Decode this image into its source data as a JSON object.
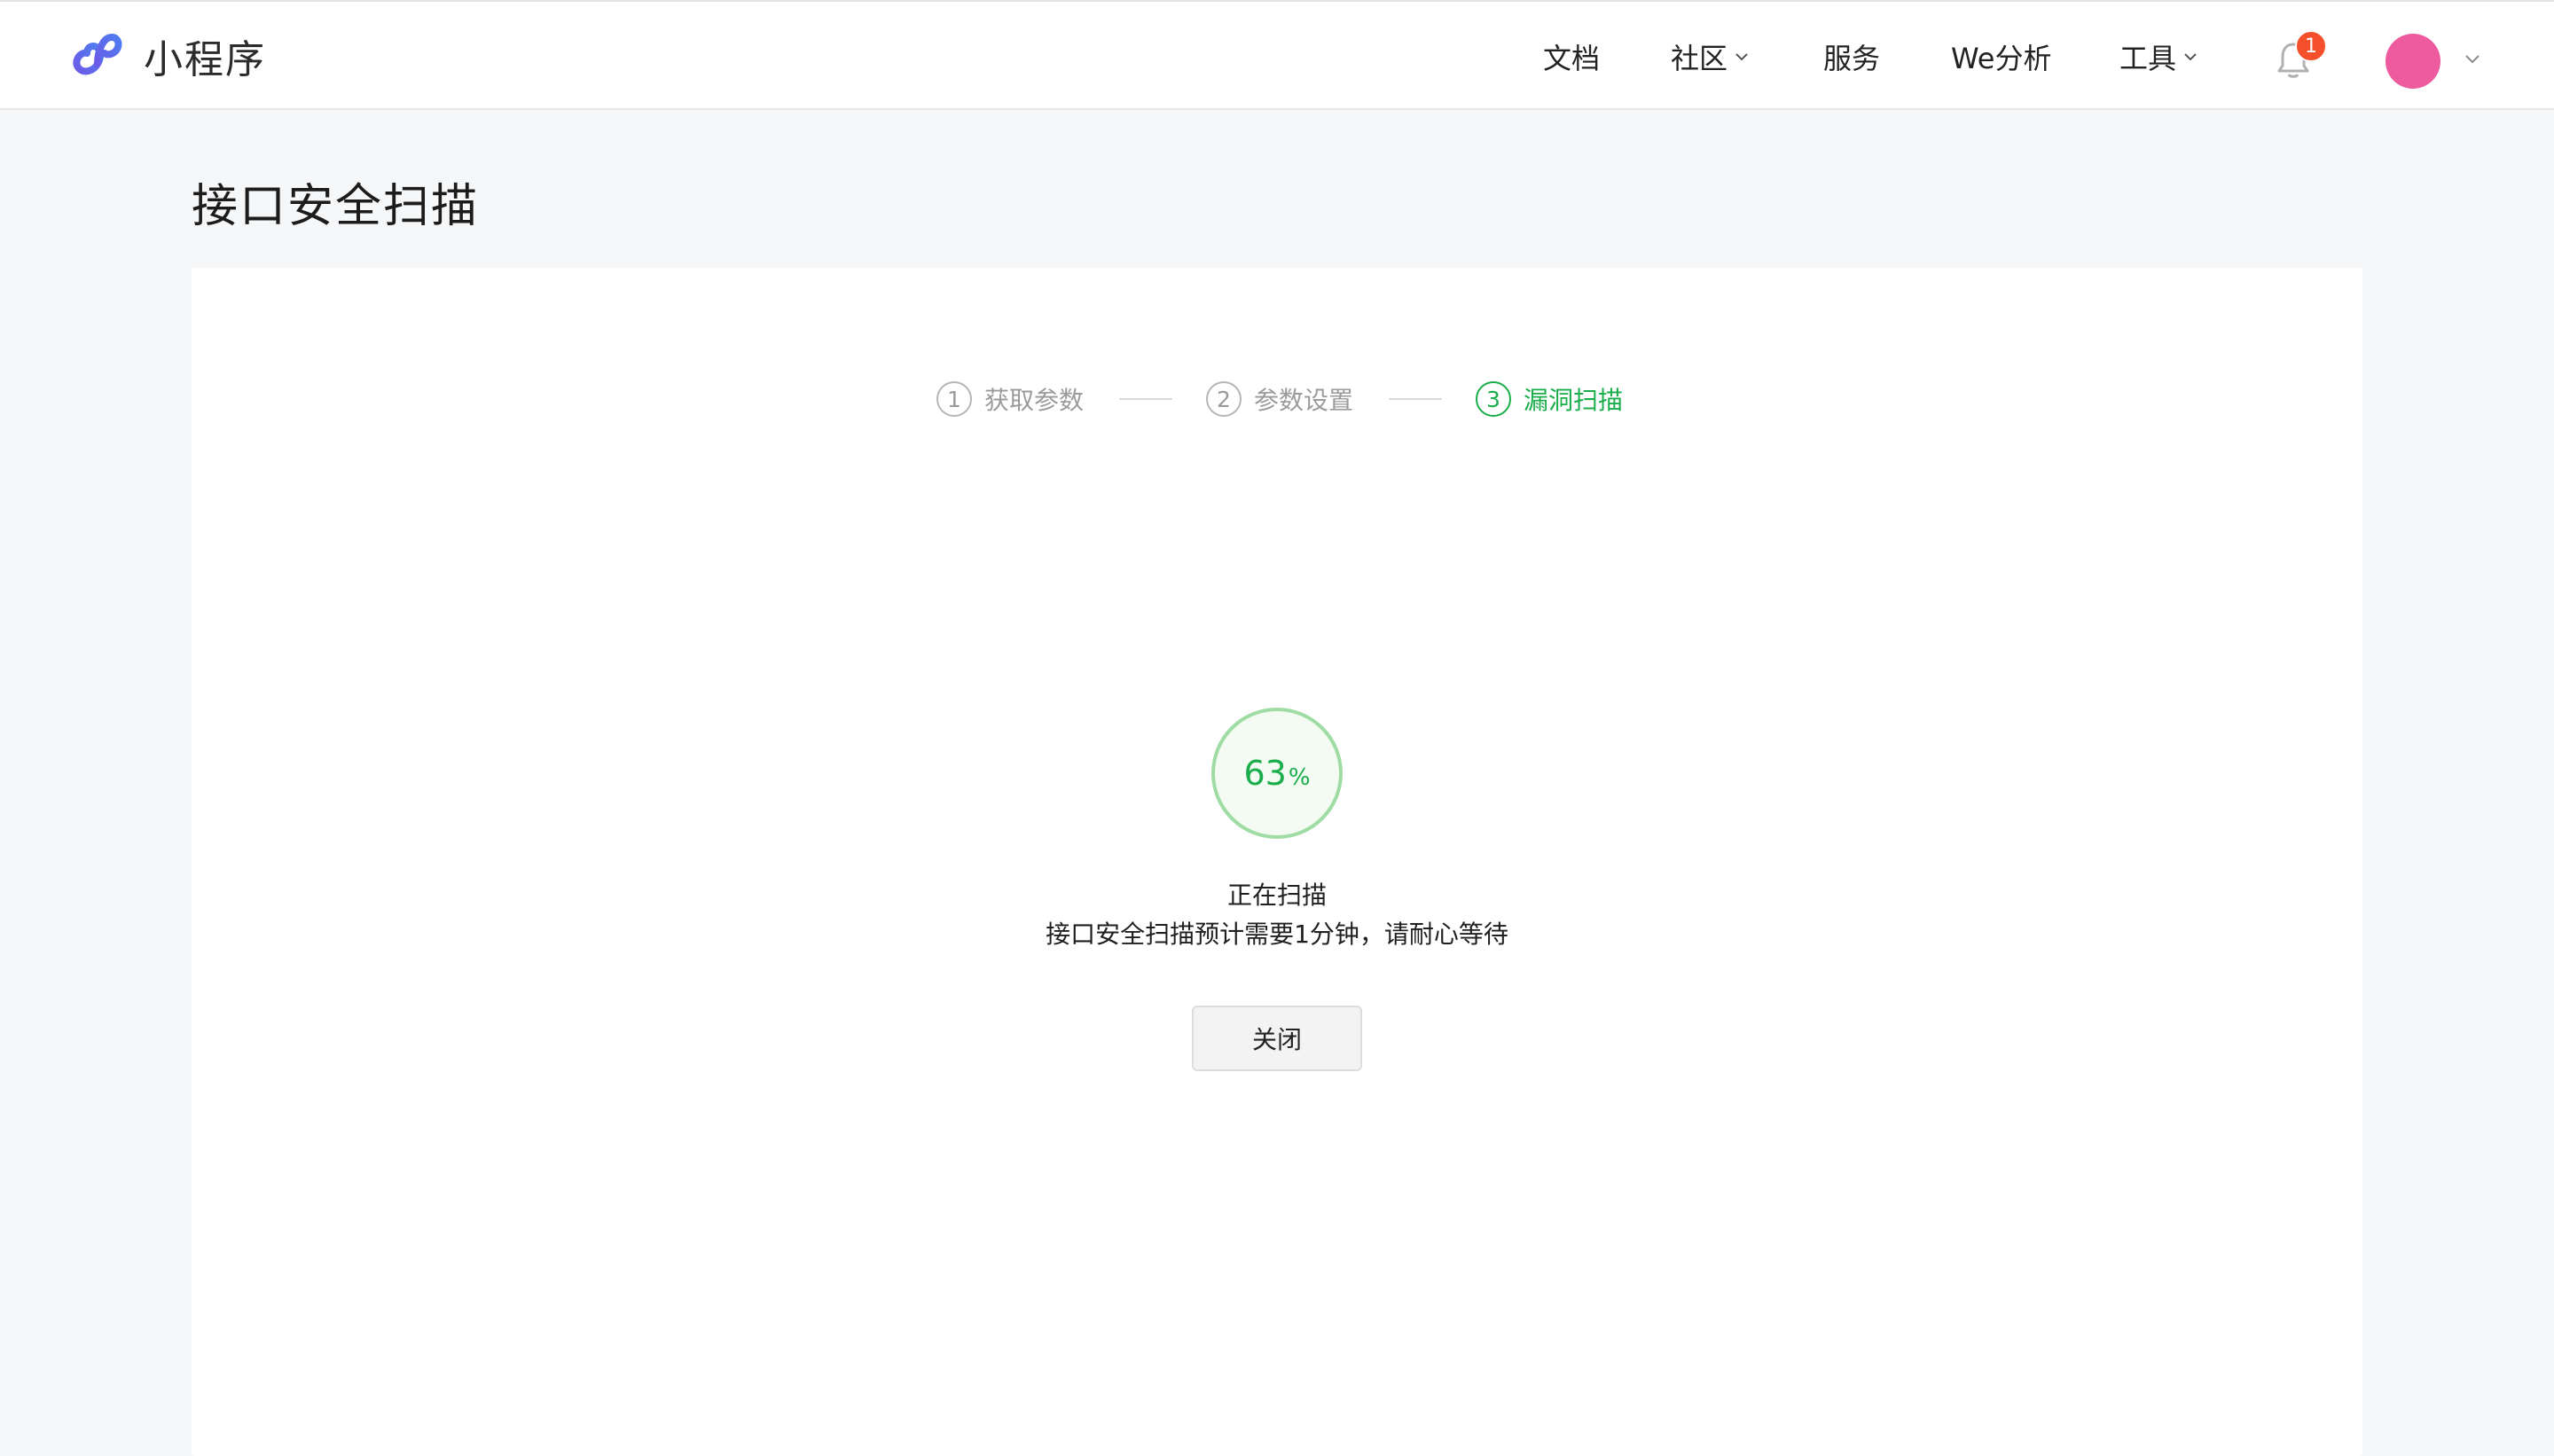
{
  "brand": {
    "name": "小程序",
    "logo_icon": "mini-program-logo-icon",
    "logo_color": "#5a67d8"
  },
  "nav": {
    "docs": "文档",
    "community": "社区",
    "services": "服务",
    "analytics": "We分析",
    "tools": "工具",
    "notification_count": "1"
  },
  "page": {
    "title": "接口安全扫描"
  },
  "steps": [
    {
      "num": "1",
      "label": "获取参数",
      "state": "done"
    },
    {
      "num": "2",
      "label": "参数设置",
      "state": "done"
    },
    {
      "num": "3",
      "label": "漏洞扫描",
      "state": "active"
    }
  ],
  "scan": {
    "progress": "63",
    "unit": "%",
    "status": "正在扫描",
    "description": "接口安全扫描预计需要1分钟，请耐心等待",
    "close_label": "关闭"
  },
  "colors": {
    "accent": "#1aad4b",
    "badge": "#f5502b",
    "avatar": "#ee5a9e"
  }
}
